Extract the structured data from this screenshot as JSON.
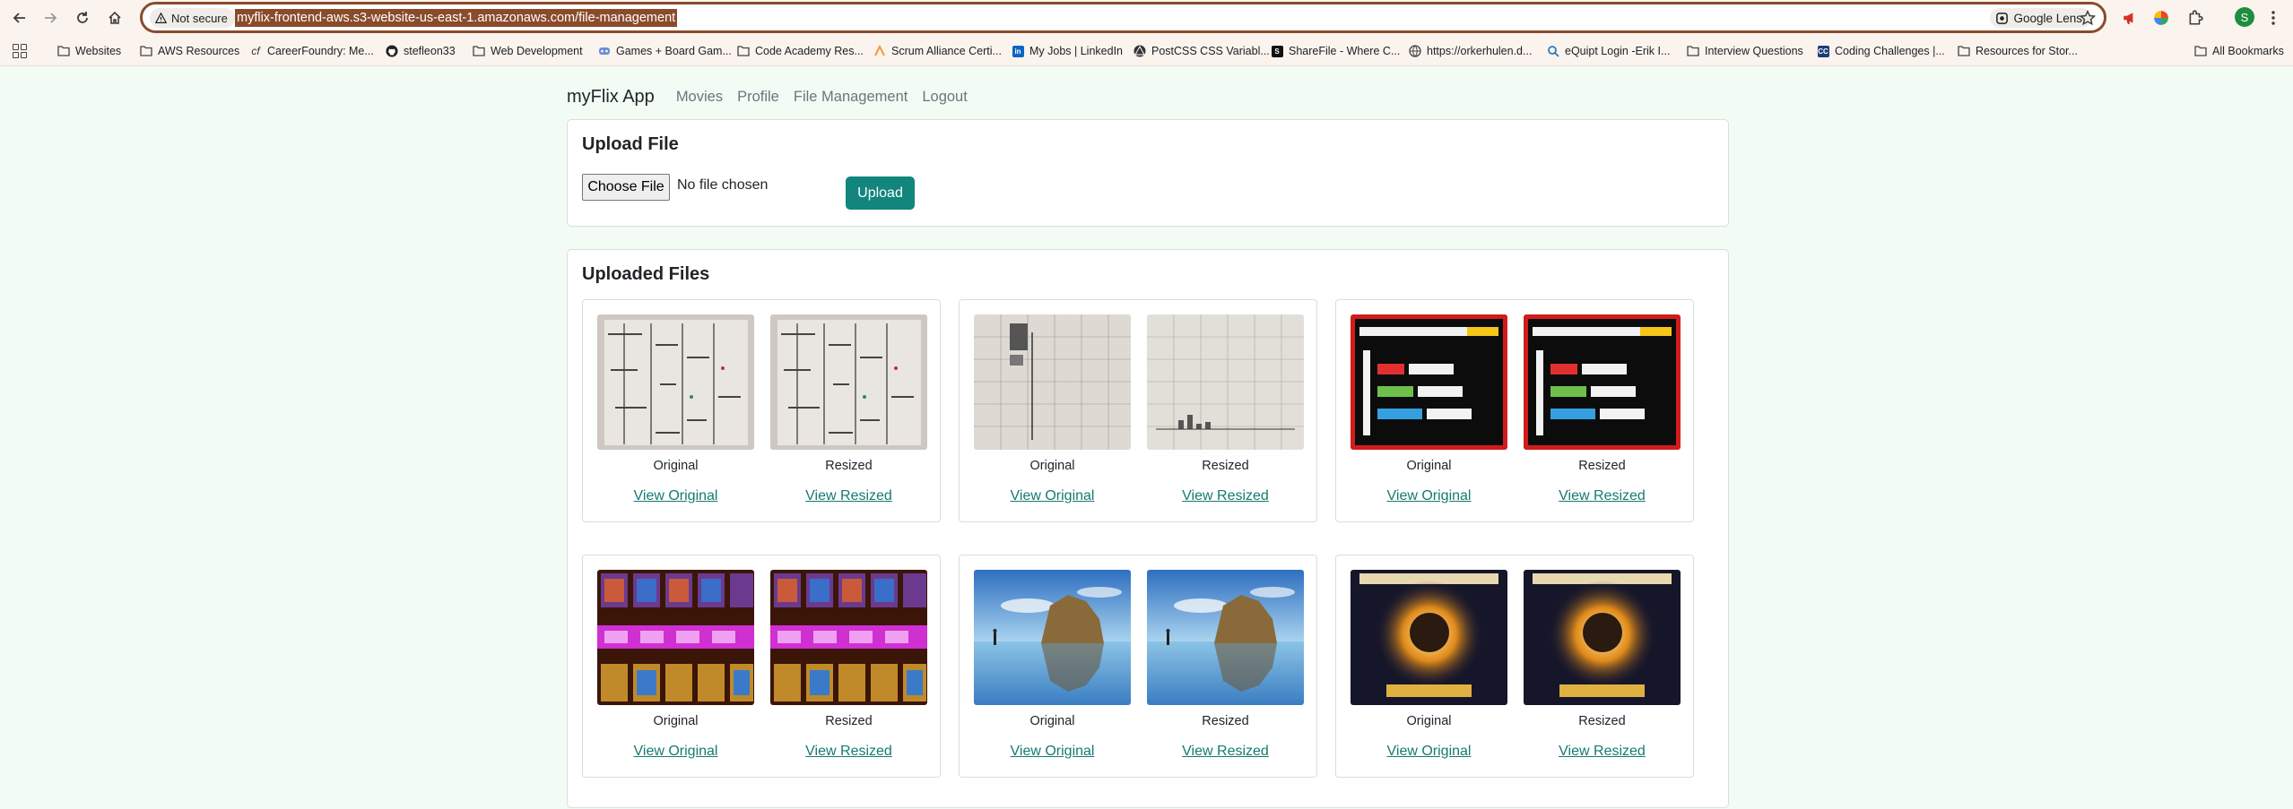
{
  "browser": {
    "security_label": "Not secure",
    "url": "myflix-frontend-aws.s3-website-us-east-1.amazonaws.com/file-management",
    "lens_label": "Google Lens",
    "profile_initial": "S",
    "bookmarks": [
      {
        "label": "Websites",
        "icon": "folder-icon"
      },
      {
        "label": "AWS Resources",
        "icon": "folder-icon"
      },
      {
        "label": "CareerFoundry: Me...",
        "icon": "careerfoundry-icon"
      },
      {
        "label": "stefleon33",
        "icon": "github-icon"
      },
      {
        "label": "Web Development",
        "icon": "folder-icon"
      },
      {
        "label": "Games + Board Gam...",
        "icon": "games-icon"
      },
      {
        "label": "Code Academy Res...",
        "icon": "folder-icon"
      },
      {
        "label": "Scrum Alliance Certi...",
        "icon": "scrum-icon"
      },
      {
        "label": "My Jobs | LinkedIn",
        "icon": "linkedin-icon"
      },
      {
        "label": "PostCSS CSS Variabl...",
        "icon": "postcss-icon"
      },
      {
        "label": "ShareFile - Where C...",
        "icon": "sharefile-icon"
      },
      {
        "label": "https://orkerhulen.d...",
        "icon": "globe-icon"
      },
      {
        "label": "eQuipt Login -Erik I...",
        "icon": "equipt-icon"
      },
      {
        "label": "Interview Questions",
        "icon": "folder-icon"
      },
      {
        "label": "Coding Challenges |...",
        "icon": "cc-icon"
      },
      {
        "label": "Resources for Stor...",
        "icon": "folder-icon"
      }
    ],
    "all_bookmarks_label": "All Bookmarks"
  },
  "nav": {
    "brand": "myFlix App",
    "links": [
      "Movies",
      "Profile",
      "File Management",
      "Logout"
    ]
  },
  "upload": {
    "title": "Upload File",
    "choose_label": "Choose File",
    "status": "No file chosen",
    "button_label": "Upload"
  },
  "files": {
    "title": "Uploaded Files",
    "original_caption": "Original",
    "resized_caption": "Resized",
    "view_original_label": "View Original",
    "view_resized_label": "View Resized",
    "items": [
      {
        "thumbnail": "handwritten-table-photo"
      },
      {
        "thumbnail": "graph-paper-photo"
      },
      {
        "thumbnail": "math-patterns-poster"
      },
      {
        "thumbnail": "game-character-cards"
      },
      {
        "thumbnail": "beach-rock-formation"
      },
      {
        "thumbnail": "harry-potter-showbill"
      }
    ]
  },
  "colors": {
    "page_background": "#f2fcf4",
    "accent": "#12857d",
    "link": "#157a72",
    "omnibox_border": "#8a4b2b"
  }
}
